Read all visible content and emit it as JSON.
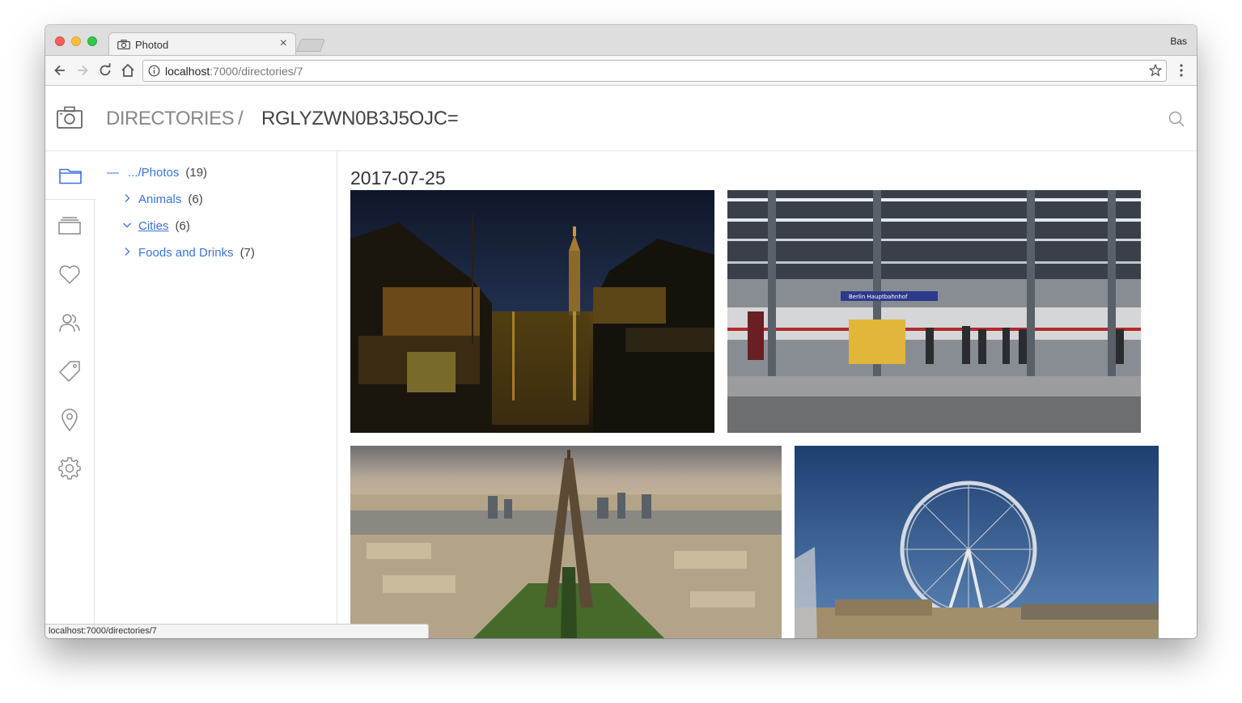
{
  "browser": {
    "tab_title": "Photod",
    "tab_close": "×",
    "profile_name": "Bas",
    "url_host": "localhost",
    "url_rest": ":7000/directories/7",
    "status_url": "localhost:7000/directories/7"
  },
  "header": {
    "crumb_root": "DIRECTORIES",
    "crumb_sep": "/",
    "crumb_current": "RGLYZWN0B3J5OJC="
  },
  "sidebar_icons": [
    "folder-icon",
    "albums-icon",
    "heart-icon",
    "people-icon",
    "tag-icon",
    "location-pin-icon",
    "settings-gear-icon"
  ],
  "tree": {
    "root": {
      "toggle": "—",
      "label": ".../Photos",
      "count": "(19)"
    },
    "items": [
      {
        "label": "Animals",
        "count": "(6)",
        "expanded": false
      },
      {
        "label": "Cities",
        "count": "(6)",
        "expanded": true
      },
      {
        "label": "Foods and Drinks",
        "count": "(7)",
        "expanded": false
      }
    ]
  },
  "content": {
    "date_heading": "2017-07-25",
    "photos": [
      {
        "name": "amsterdam-canal-night"
      },
      {
        "name": "berlin-hauptbahnhof-platform",
        "sign": "Berlin Hauptbahnhof"
      },
      {
        "name": "paris-eiffel-tower-aerial"
      },
      {
        "name": "london-eye"
      }
    ]
  },
  "colors": {
    "link": "#3b73d9",
    "accent_icon": "#3b73d9",
    "muted_icon": "#8a8a8a"
  }
}
